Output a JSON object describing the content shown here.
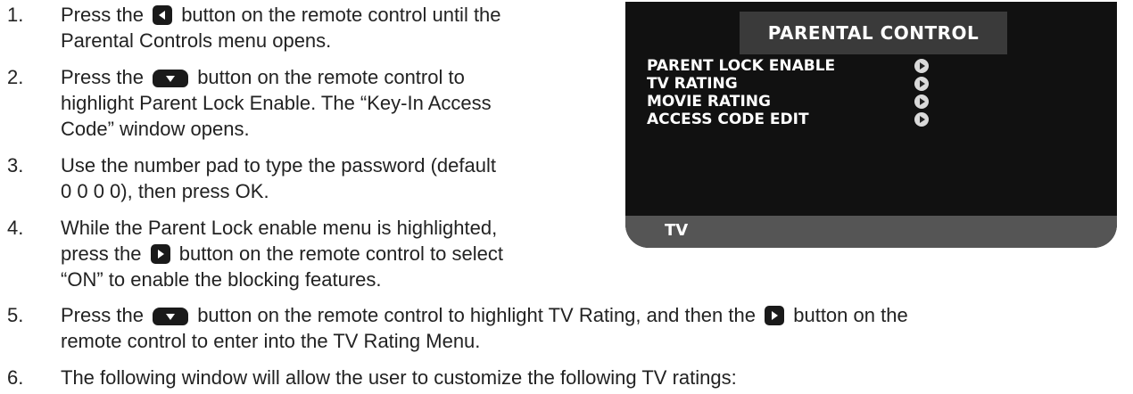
{
  "steps": [
    {
      "number": "1.",
      "lines": [
        {
          "pre": "Press the",
          "button": "left",
          "post": "button on the remote control until the"
        },
        {
          "text": "Parental Controls menu opens."
        }
      ]
    },
    {
      "number": "2.",
      "lines": [
        {
          "pre": "Press the",
          "button": "down",
          "post": "button on the remote control to"
        },
        {
          "text": "highlight Parent Lock Enable. The “Key-In Access"
        },
        {
          "text": "Code” window opens."
        }
      ]
    },
    {
      "number": "3.",
      "lines": [
        {
          "text": "Use the number pad to type the password (default"
        },
        {
          "text": "0 0 0 0), then press OK."
        }
      ]
    },
    {
      "number": "4.",
      "lines": [
        {
          "text": "While the Parent Lock enable menu is highlighted,"
        },
        {
          "pre": "press the",
          "button": "right",
          "post": "button on the remote control to select"
        },
        {
          "text": "“ON” to enable the blocking features."
        }
      ]
    },
    {
      "number": "5.",
      "lines": [
        {
          "pre": "Press the",
          "button": "down",
          "post": "button on the remote control to highlight TV Rating, and then the",
          "button2": "right",
          "post2": "button on the"
        },
        {
          "text": "remote control to enter into the TV Rating Menu."
        }
      ]
    },
    {
      "number": "6.",
      "lines": [
        {
          "text": "The following window will allow the user to customize the following TV ratings:"
        }
      ]
    }
  ],
  "screen": {
    "title": "PARENTAL CONTROL",
    "menu": [
      "PARENT LOCK ENABLE",
      "TV RATING",
      "MOVIE RATING",
      "ACCESS CODE EDIT"
    ],
    "footer": "TV",
    "arrow_icon": "right-arrow-circle-icon"
  },
  "colors": {
    "screen_bg": "#111111",
    "text": "#222222"
  }
}
